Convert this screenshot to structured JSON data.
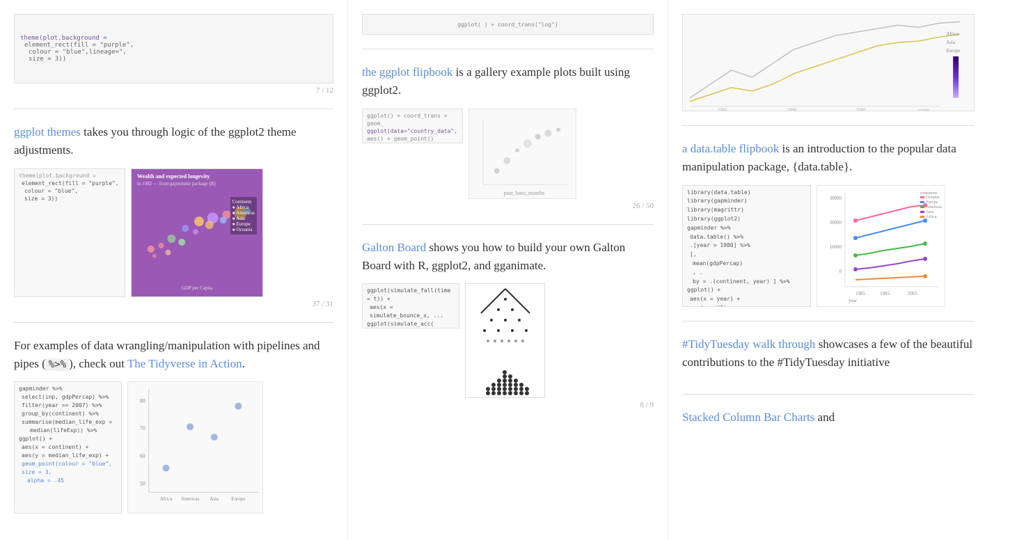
{
  "columns": {
    "col1": {
      "sections": [
        {
          "id": "col1-top",
          "slide_counter": "7 / 12",
          "has_top_image": true
        },
        {
          "id": "ggplot-themes",
          "link_text": "ggplot themes",
          "description": " takes you through logic of the ggplot2 theme adjustments.",
          "slide_counter": "37 / 31",
          "has_preview": true
        },
        {
          "id": "tidyverse",
          "text_before": "For examples of data wrangling/manipulation with pipelines and pipes (",
          "inline_code": "%>%",
          "text_after": "), check out ",
          "link_text": "The Tidyverse in Action",
          "text_end": ".",
          "has_preview": true
        }
      ]
    },
    "col2": {
      "sections": [
        {
          "id": "col2-top",
          "has_top_image": true
        },
        {
          "id": "ggplot-flipbook",
          "link_text": "the ggplot flipbook",
          "description": " is a gallery example plots built using ggplot2.",
          "has_preview": true,
          "slide_counter": "26 / 50"
        },
        {
          "id": "galton-board",
          "link_text": "Galton Board",
          "description": " shows you how to build your own Galton Board with R, ggplot2, and gganimate.",
          "has_preview": true,
          "slide_counter": "8 / 9"
        }
      ]
    },
    "col3": {
      "sections": [
        {
          "id": "col3-top",
          "has_top_image": true
        },
        {
          "id": "datatable-flipbook",
          "link_text": "a data.table flipbook",
          "description": " is an introduction to the popular data manipulation package, {data.table}.",
          "has_preview": true
        },
        {
          "id": "tidytuesday",
          "link_text": "#TidyTuesday walk through",
          "description": " showcases a few of the beautiful contributions to the #TidyTuesday initiative",
          "has_preview": false
        },
        {
          "id": "stacked-col",
          "link_text": "Stacked Column Bar Charts",
          "description": " and",
          "partial": true
        }
      ]
    }
  }
}
